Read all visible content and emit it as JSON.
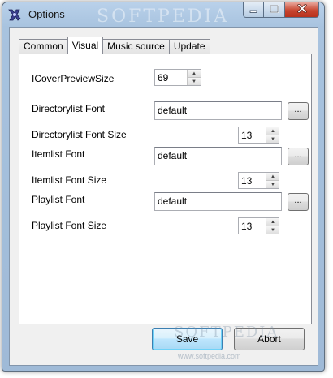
{
  "window": {
    "title": "Options",
    "watermark": "SOFTPEDIA",
    "watermark_url": "www.softpedia.com"
  },
  "tabs": [
    {
      "label": "Common",
      "active": false
    },
    {
      "label": "Visual",
      "active": true
    },
    {
      "label": "Music source",
      "active": false
    },
    {
      "label": "Update",
      "active": false
    }
  ],
  "visual": {
    "cover_preview_size_label": "ICoverPreviewSize",
    "cover_preview_size_value": "69",
    "directorylist_font_label": "Directorylist Font",
    "directorylist_font_value": "default",
    "directorylist_font_size_label": "Directorylist Font Size",
    "directorylist_font_size_value": "13",
    "itemlist_font_label": "Itemlist Font",
    "itemlist_font_value": "default",
    "itemlist_font_size_label": "Itemlist Font Size",
    "itemlist_font_size_value": "13",
    "playlist_font_label": "Playlist Font",
    "playlist_font_value": "default",
    "playlist_font_size_label": "Playlist Font Size",
    "playlist_font_size_value": "13",
    "browse_label": "..."
  },
  "buttons": {
    "save": "Save",
    "abort": "Abort"
  },
  "icons": {
    "app": "app-icon",
    "minimize": "minimize-icon",
    "maximize": "maximize-icon",
    "close": "close-icon",
    "spin_up": "▲",
    "spin_down": "▼"
  }
}
